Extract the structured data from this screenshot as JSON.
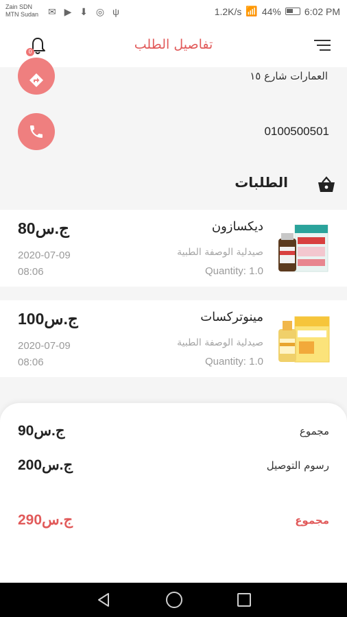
{
  "status_bar": {
    "carrier_line1": "Zain SDN",
    "carrier_line2": "MTN Sudan",
    "speed": "1.2K/s",
    "battery": "44%",
    "time": "6:02 PM"
  },
  "header": {
    "title": "تفاصيل الطلب",
    "notification_count": "0"
  },
  "address": {
    "text": "العمارات شارع ١٥"
  },
  "phone": {
    "number": "0100500501"
  },
  "orders": {
    "title": "الطلبات",
    "items": [
      {
        "name": "ديكسازون",
        "pharmacy": "صيدلية الوصفة الطبية",
        "quantity": "Quantity: 1.0",
        "price": "ج.س80",
        "date": "2020-07-09",
        "time": "08:06"
      },
      {
        "name": "مينوتركسات",
        "pharmacy": "صيدلية الوصفة الطبية",
        "quantity": "Quantity: 1.0",
        "price": "ج.س100",
        "date": "2020-07-09",
        "time": "08:06"
      }
    ]
  },
  "summary": {
    "subtotal_label": "مجموع",
    "subtotal_value": "ج.س90",
    "delivery_label": "رسوم التوصيل",
    "delivery_value": "ج.س200",
    "total_label": "مجموع",
    "total_value": "ج.س290"
  },
  "colors": {
    "accent": "#e15a5a",
    "icon_circle": "#ef7f7f"
  }
}
